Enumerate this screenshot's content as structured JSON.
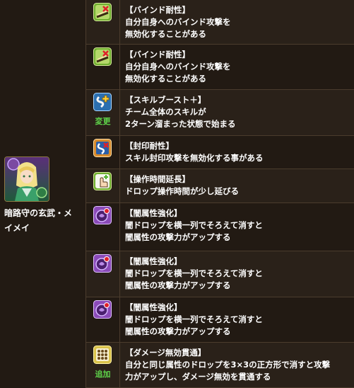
{
  "character": {
    "name_line1": "暗路守の玄武・メ",
    "name_line2": "イメイ"
  },
  "rows": [
    {
      "icon": "bind-resist-icon",
      "tag": "",
      "title": "【バインド耐性】",
      "lines": [
        "自分自身へのバインド攻撃を",
        "無効化することがある"
      ]
    },
    {
      "icon": "bind-resist-icon",
      "tag": "",
      "title": "【バインド耐性】",
      "lines": [
        "自分自身へのバインド攻撃を",
        "無効化することがある"
      ]
    },
    {
      "icon": "skill-boost-plus-icon",
      "tag": "変更",
      "title": "【スキルブースト＋】",
      "lines": [
        "チーム全体のスキルが",
        "2ターン溜まった状態で始まる"
      ]
    },
    {
      "icon": "seal-resist-icon",
      "tag": "",
      "title": "【封印耐性】",
      "lines": [
        "スキル封印攻撃を無効化する事がある"
      ]
    },
    {
      "icon": "time-extend-icon",
      "tag": "",
      "title": "【操作時間延長】",
      "lines": [
        "ドロップ操作時間が少し延びる"
      ]
    },
    {
      "icon": "dark-enhance-icon",
      "tag": "",
      "title": "【闇属性強化】",
      "lines": [
        "闇ドロップを横一列でそろえて消すと",
        "闇属性の攻撃力がアップする"
      ]
    },
    {
      "icon": "dark-enhance-icon",
      "tag": "",
      "title": "【闇属性強化】",
      "lines": [
        "闇ドロップを横一列でそろえて消すと",
        "闇属性の攻撃力がアップする"
      ]
    },
    {
      "icon": "dark-enhance-icon",
      "tag": "",
      "title": "【闇属性強化】",
      "lines": [
        "闇ドロップを横一列でそろえて消すと",
        "闇属性の攻撃力がアップする"
      ]
    },
    {
      "icon": "damage-void-pierce-icon",
      "tag": "追加",
      "title": "【ダメージ無効貫通】",
      "lines": [
        "自分と同じ属性のドロップを3×3の正方形で消すと攻撃",
        "力がアップし、ダメージ無効を貫通する"
      ]
    }
  ],
  "colors": {
    "tag": "#5fd34a",
    "title": "#ffffff"
  }
}
